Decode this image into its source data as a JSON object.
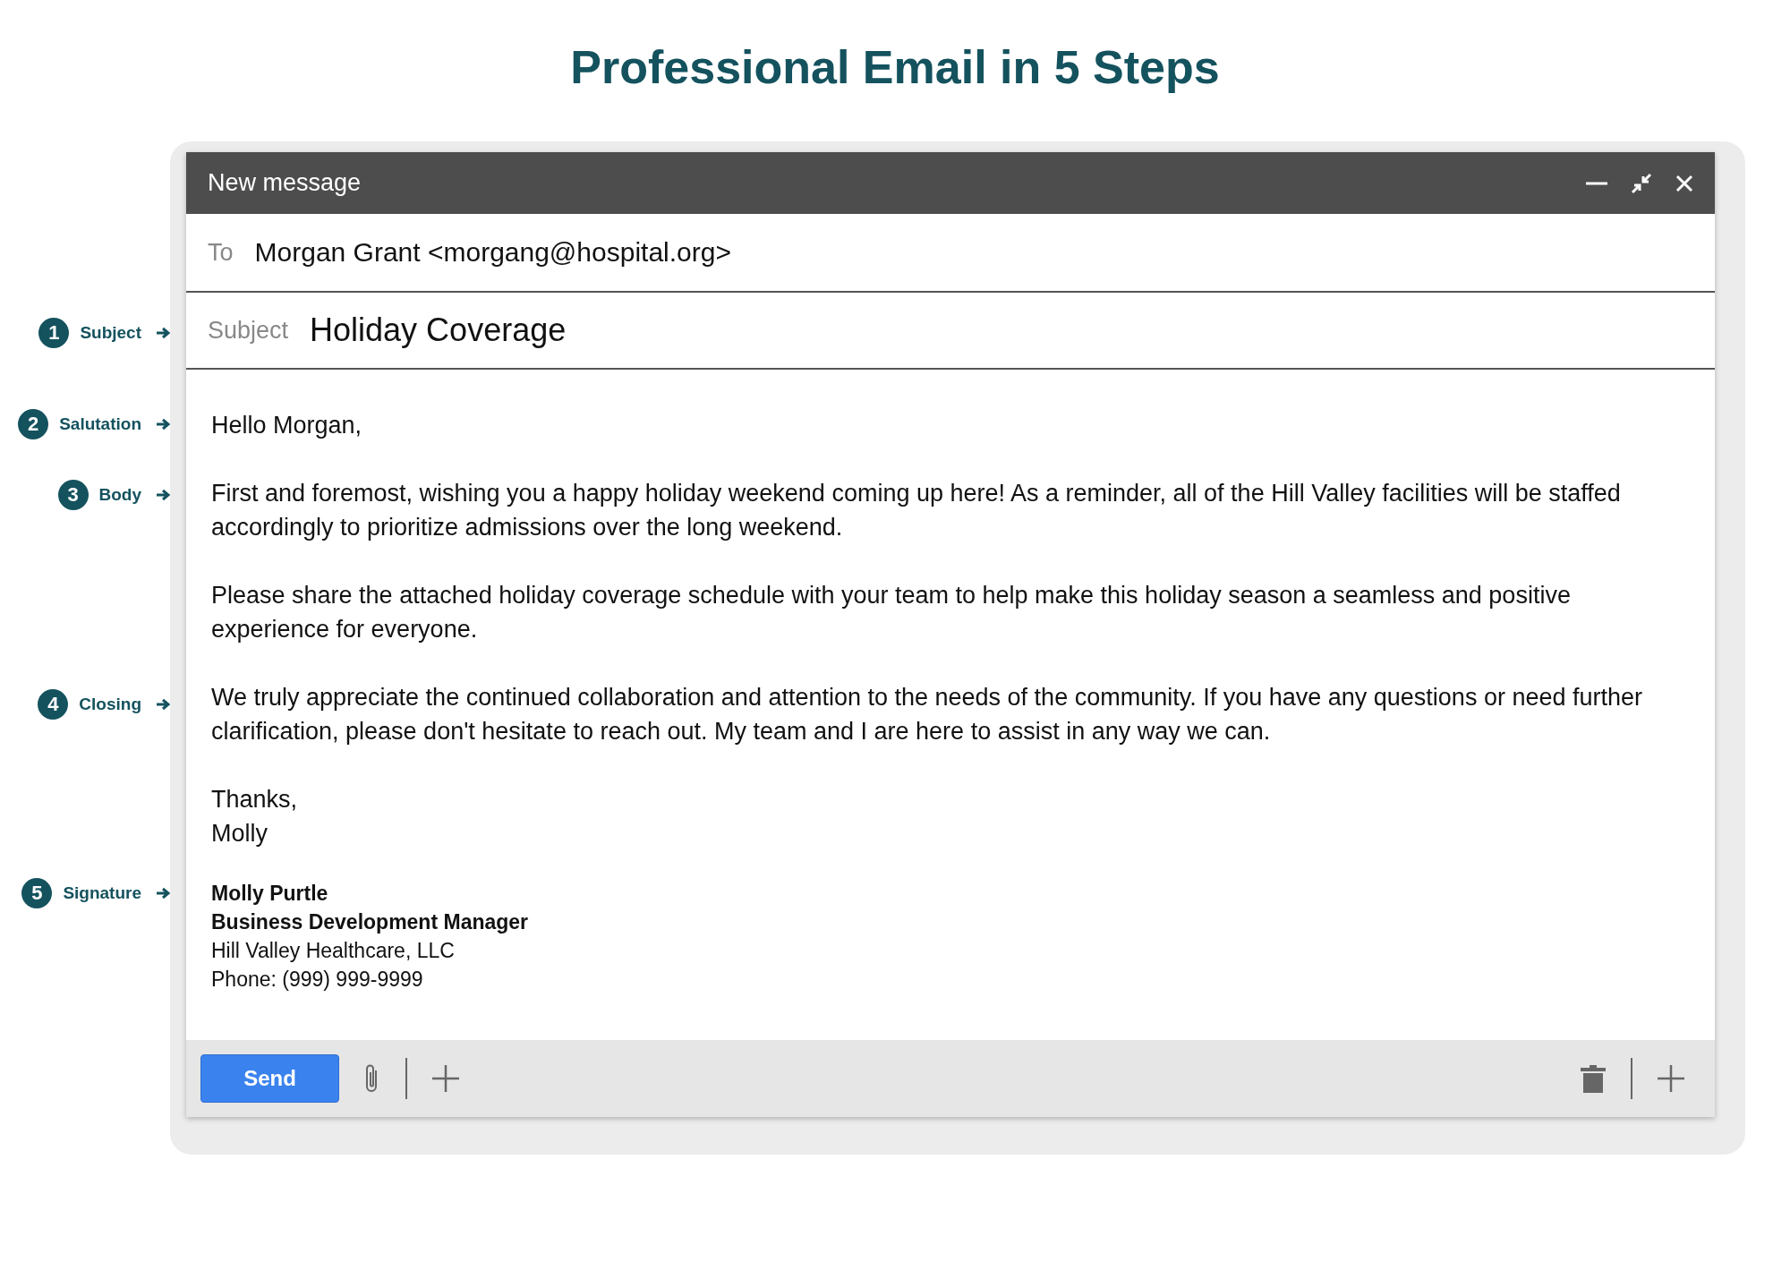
{
  "title": "Professional Email in 5 Steps",
  "annotations": [
    {
      "number": "1",
      "label": "Subject"
    },
    {
      "number": "2",
      "label": "Salutation"
    },
    {
      "number": "3",
      "label": "Body"
    },
    {
      "number": "4",
      "label": "Closing"
    },
    {
      "number": "5",
      "label": "Signature"
    }
  ],
  "window": {
    "title": "New message"
  },
  "to": {
    "label": "To",
    "value": "Morgan Grant <morgang@hospital.org>"
  },
  "subject": {
    "label": "Subject",
    "value": "Holiday Coverage"
  },
  "body": {
    "greeting": "Hello Morgan,",
    "paragraphs": [
      "First and foremost, wishing you a happy holiday weekend coming up here! As a reminder, all of the Hill Valley facilities will be staffed accordingly to prioritize admissions over the long weekend.",
      "Please share the attached holiday coverage schedule with your team to help make this holiday season a seamless and positive experience for everyone.",
      "We truly appreciate the continued collaboration and attention to the needs of the community. If you have any questions or need further clarification, please don't hesitate to reach out. My team and I are here to assist in any way we can."
    ],
    "closing": [
      "Thanks,",
      "Molly"
    ]
  },
  "signature": [
    {
      "text": "Molly Purtle",
      "bold": true
    },
    {
      "text": "Business Development Manager",
      "bold": true
    },
    {
      "text": "Hill Valley Healthcare, LLC",
      "bold": false
    },
    {
      "text": "Phone: (999) 999-9999",
      "bold": false
    }
  ],
  "footer": {
    "send": "Send"
  }
}
